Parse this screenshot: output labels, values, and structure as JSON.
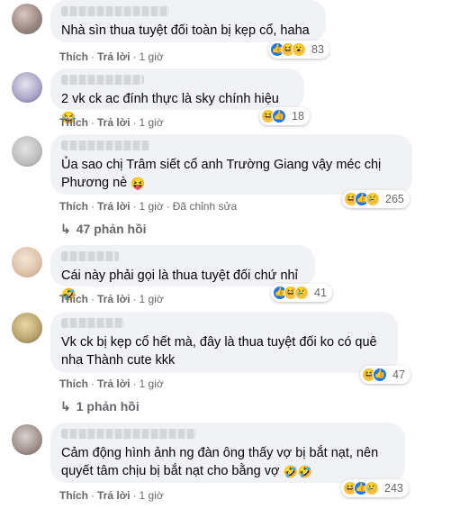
{
  "comments": [
    {
      "text": "Nhà sìn thua tuyệt đối toàn bị kẹp cổ, haha",
      "emoji": "",
      "reactions": [
        "like",
        "haha",
        "wow"
      ],
      "count": "83",
      "actions": {
        "like": "Thích",
        "reply": "Trả lời",
        "time": "1 giờ",
        "edited": ""
      },
      "replies": ""
    },
    {
      "text": "2 vk ck ac đính thực là sky chính hiệu",
      "emoji": "😂",
      "reactions": [
        "haha",
        "like"
      ],
      "count": "18",
      "actions": {
        "like": "Thích",
        "reply": "Trả lời",
        "time": "1 giờ",
        "edited": ""
      },
      "replies": ""
    },
    {
      "text": "Ủa sao chị Trâm siết cổ anh Trường Giang vậy méc chị\nPhương nè",
      "emoji": "😝",
      "reactions": [
        "haha",
        "like",
        "sad"
      ],
      "count": "265",
      "actions": {
        "like": "Thích",
        "reply": "Trả lời",
        "time": "1 giờ",
        "edited": "Đã chỉnh sửa"
      },
      "replies": "47 phản hồi"
    },
    {
      "text": "Cái này phải gọi là thua tuyệt đối chứ nhỉ",
      "emoji": "🤣",
      "reactions": [
        "like",
        "haha",
        "sad"
      ],
      "count": "41",
      "actions": {
        "like": "Thích",
        "reply": "Trả lời",
        "time": "1 giờ",
        "edited": ""
      },
      "replies": ""
    },
    {
      "text": "Vk ck bị kẹp cổ hết mà, đây là thua tuyệt đối ko có quê\nnha Thành cute kkk",
      "emoji": "",
      "reactions": [
        "haha",
        "like"
      ],
      "count": "47",
      "actions": {
        "like": "Thích",
        "reply": "Trả lời",
        "time": "1 giờ",
        "edited": ""
      },
      "replies": "1 phản hồi"
    },
    {
      "text": "Cảm động hình ảnh ng đàn ông thấy vợ bị bắt nạt, nên\nquyết tâm chịu bị bắt nạt cho bằng vợ",
      "emoji": "🤣🤣",
      "reactions": [
        "haha",
        "like",
        "sad"
      ],
      "count": "243",
      "actions": {
        "like": "Thích",
        "reply": "Trả lời",
        "time": "1 giờ",
        "edited": ""
      },
      "replies": ""
    }
  ],
  "reply_arrow": "↳",
  "colors": {
    "bubble": "#f0f2f5",
    "meta": "#65676b",
    "like": "#1877f2",
    "emoji": "#f7c447"
  }
}
